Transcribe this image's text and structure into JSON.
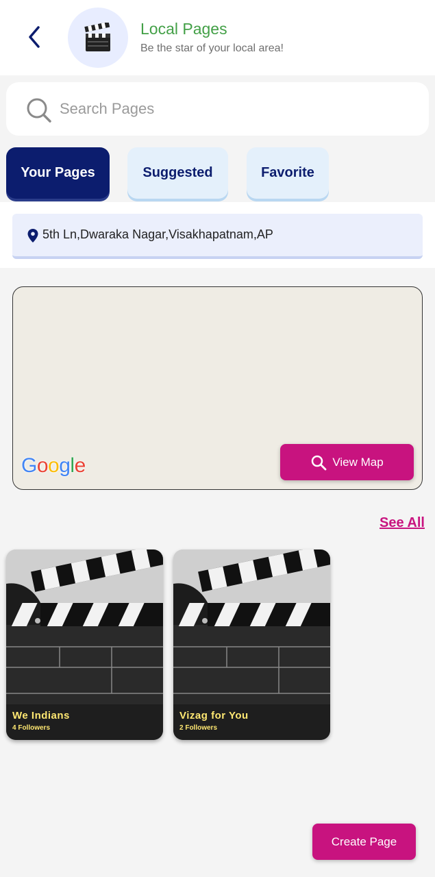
{
  "header": {
    "title": "Local Pages",
    "subtitle": "Be the star of your local area!",
    "avatar_icon": "clapperboard-icon",
    "title_color": "#43a047"
  },
  "search": {
    "placeholder": "Search Pages",
    "value": ""
  },
  "tabs": [
    {
      "label": "Your Pages",
      "active": true
    },
    {
      "label": "Suggested",
      "active": false
    },
    {
      "label": "Favorite",
      "active": false
    }
  ],
  "location": {
    "address": "5th Ln,Dwaraka Nagar,Visakhapatnam,AP",
    "icon": "location-pin-icon"
  },
  "map": {
    "provider_logo": "Google",
    "view_map_label": "View Map"
  },
  "section": {
    "see_all_label": "See All"
  },
  "pages": [
    {
      "name": "We Indians",
      "followers": "4 Followers",
      "thumbnail": "clapperboard"
    },
    {
      "name": "Vizag for You",
      "followers": "2 Followers",
      "thumbnail": "clapperboard"
    }
  ],
  "actions": {
    "create_page_label": "Create Page"
  },
  "colors": {
    "primary_navy": "#0c1d6e",
    "accent_magenta": "#c8137f",
    "tab_inactive_bg": "#e4f0fb",
    "location_bg": "#ebeffc"
  }
}
